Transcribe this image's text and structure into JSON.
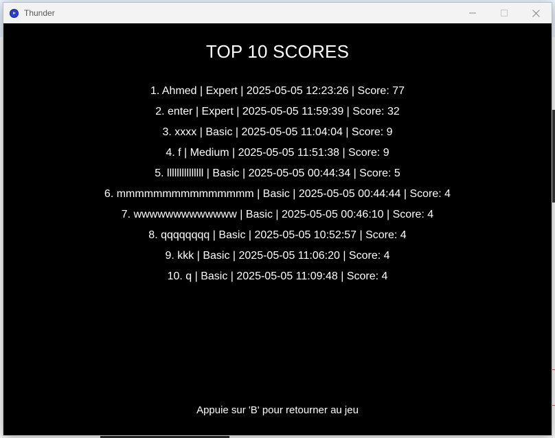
{
  "window": {
    "title": "Thunder",
    "controls": {
      "minimize_icon": "minimize-icon",
      "maximize_icon": "maximize-icon",
      "close_icon": "close-icon"
    }
  },
  "leaderboard": {
    "title": "TOP 10 SCORES",
    "rows": [
      "1. Ahmed | Expert | 2025-05-05 12:23:26 | Score: 77",
      "2. enter | Expert | 2025-05-05 11:59:39 | Score: 32",
      "3. xxxx | Basic | 2025-05-05 11:04:04 | Score: 9",
      "4. f | Medium | 2025-05-05 11:51:38 | Score: 9",
      "5. lllllllllllllll | Basic | 2025-05-05 00:44:34 | Score: 5",
      "6. mmmmmmmmmmmmmmm | Basic | 2025-05-05 00:44:44 | Score: 4",
      "7. wwwwwwwwwwwww | Basic | 2025-05-05 00:46:10 | Score: 4",
      "8. qqqqqqqq | Basic | 2025-05-05 10:52:57 | Score: 4",
      "9. kkk | Basic | 2025-05-05 11:06:20 | Score: 4",
      "10. q | Basic | 2025-05-05 11:09:48 | Score: 4"
    ],
    "hint": "Appuie sur 'B' pour retourner au jeu"
  },
  "colors": {
    "background": "#000000",
    "text": "#ffffff",
    "titlebar": "#f3f3f3",
    "app_icon": "#2e3ec8"
  }
}
